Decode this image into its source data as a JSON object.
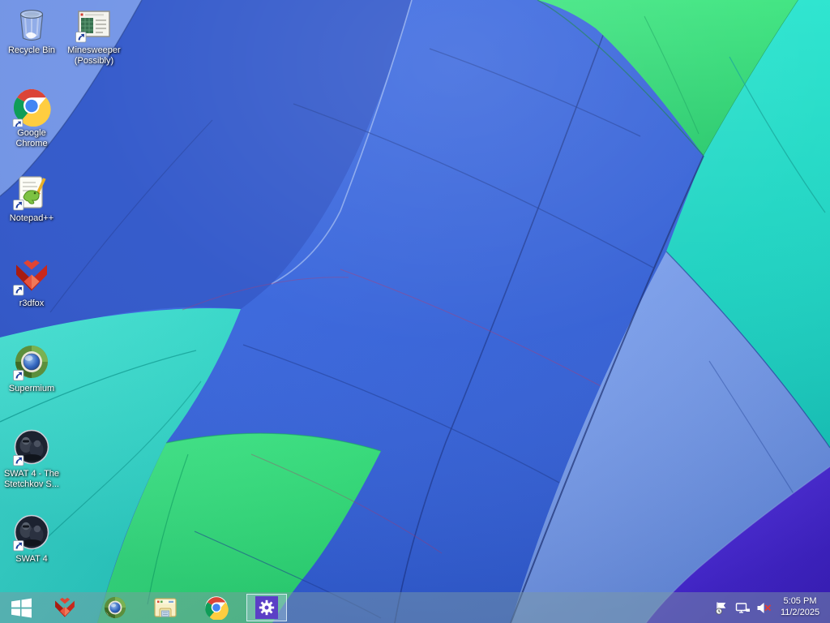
{
  "desktop": {
    "icons": [
      {
        "id": "recycle-bin",
        "label": "Recycle Bin"
      },
      {
        "id": "minesweeper",
        "label": "Minesweeper (Possibly)"
      },
      {
        "id": "google-chrome",
        "label": "Google Chrome"
      },
      {
        "id": "notepad-plus",
        "label": "Notepad++"
      },
      {
        "id": "r3dfox",
        "label": "r3dfox"
      },
      {
        "id": "supermium",
        "label": "Supermium"
      },
      {
        "id": "swat4-stetchkov",
        "label": "SWAT 4 - The Stetchkov S..."
      },
      {
        "id": "swat4",
        "label": "SWAT 4"
      }
    ]
  },
  "taskbar": {
    "start": "Start",
    "pinned": [
      "r3dfox",
      "Supermium",
      "File Explorer",
      "Google Chrome",
      "Settings"
    ],
    "active_app": "Settings"
  },
  "tray": {
    "icons": [
      "action-center-flag",
      "network",
      "volume-muted"
    ],
    "time": "5:05 PM",
    "date": "11/2/2025"
  },
  "wallpaper": {
    "subject": "hot air balloon canopy close-up",
    "palette": {
      "light_blue": "#7093E6",
      "royal_blue": "#3566DE",
      "dark_royal": "#2E55C9",
      "teal": "#2ED8CA",
      "green": "#30DC7C",
      "periwinkle": "#6E93E2",
      "indigo": "#4724D4"
    }
  }
}
